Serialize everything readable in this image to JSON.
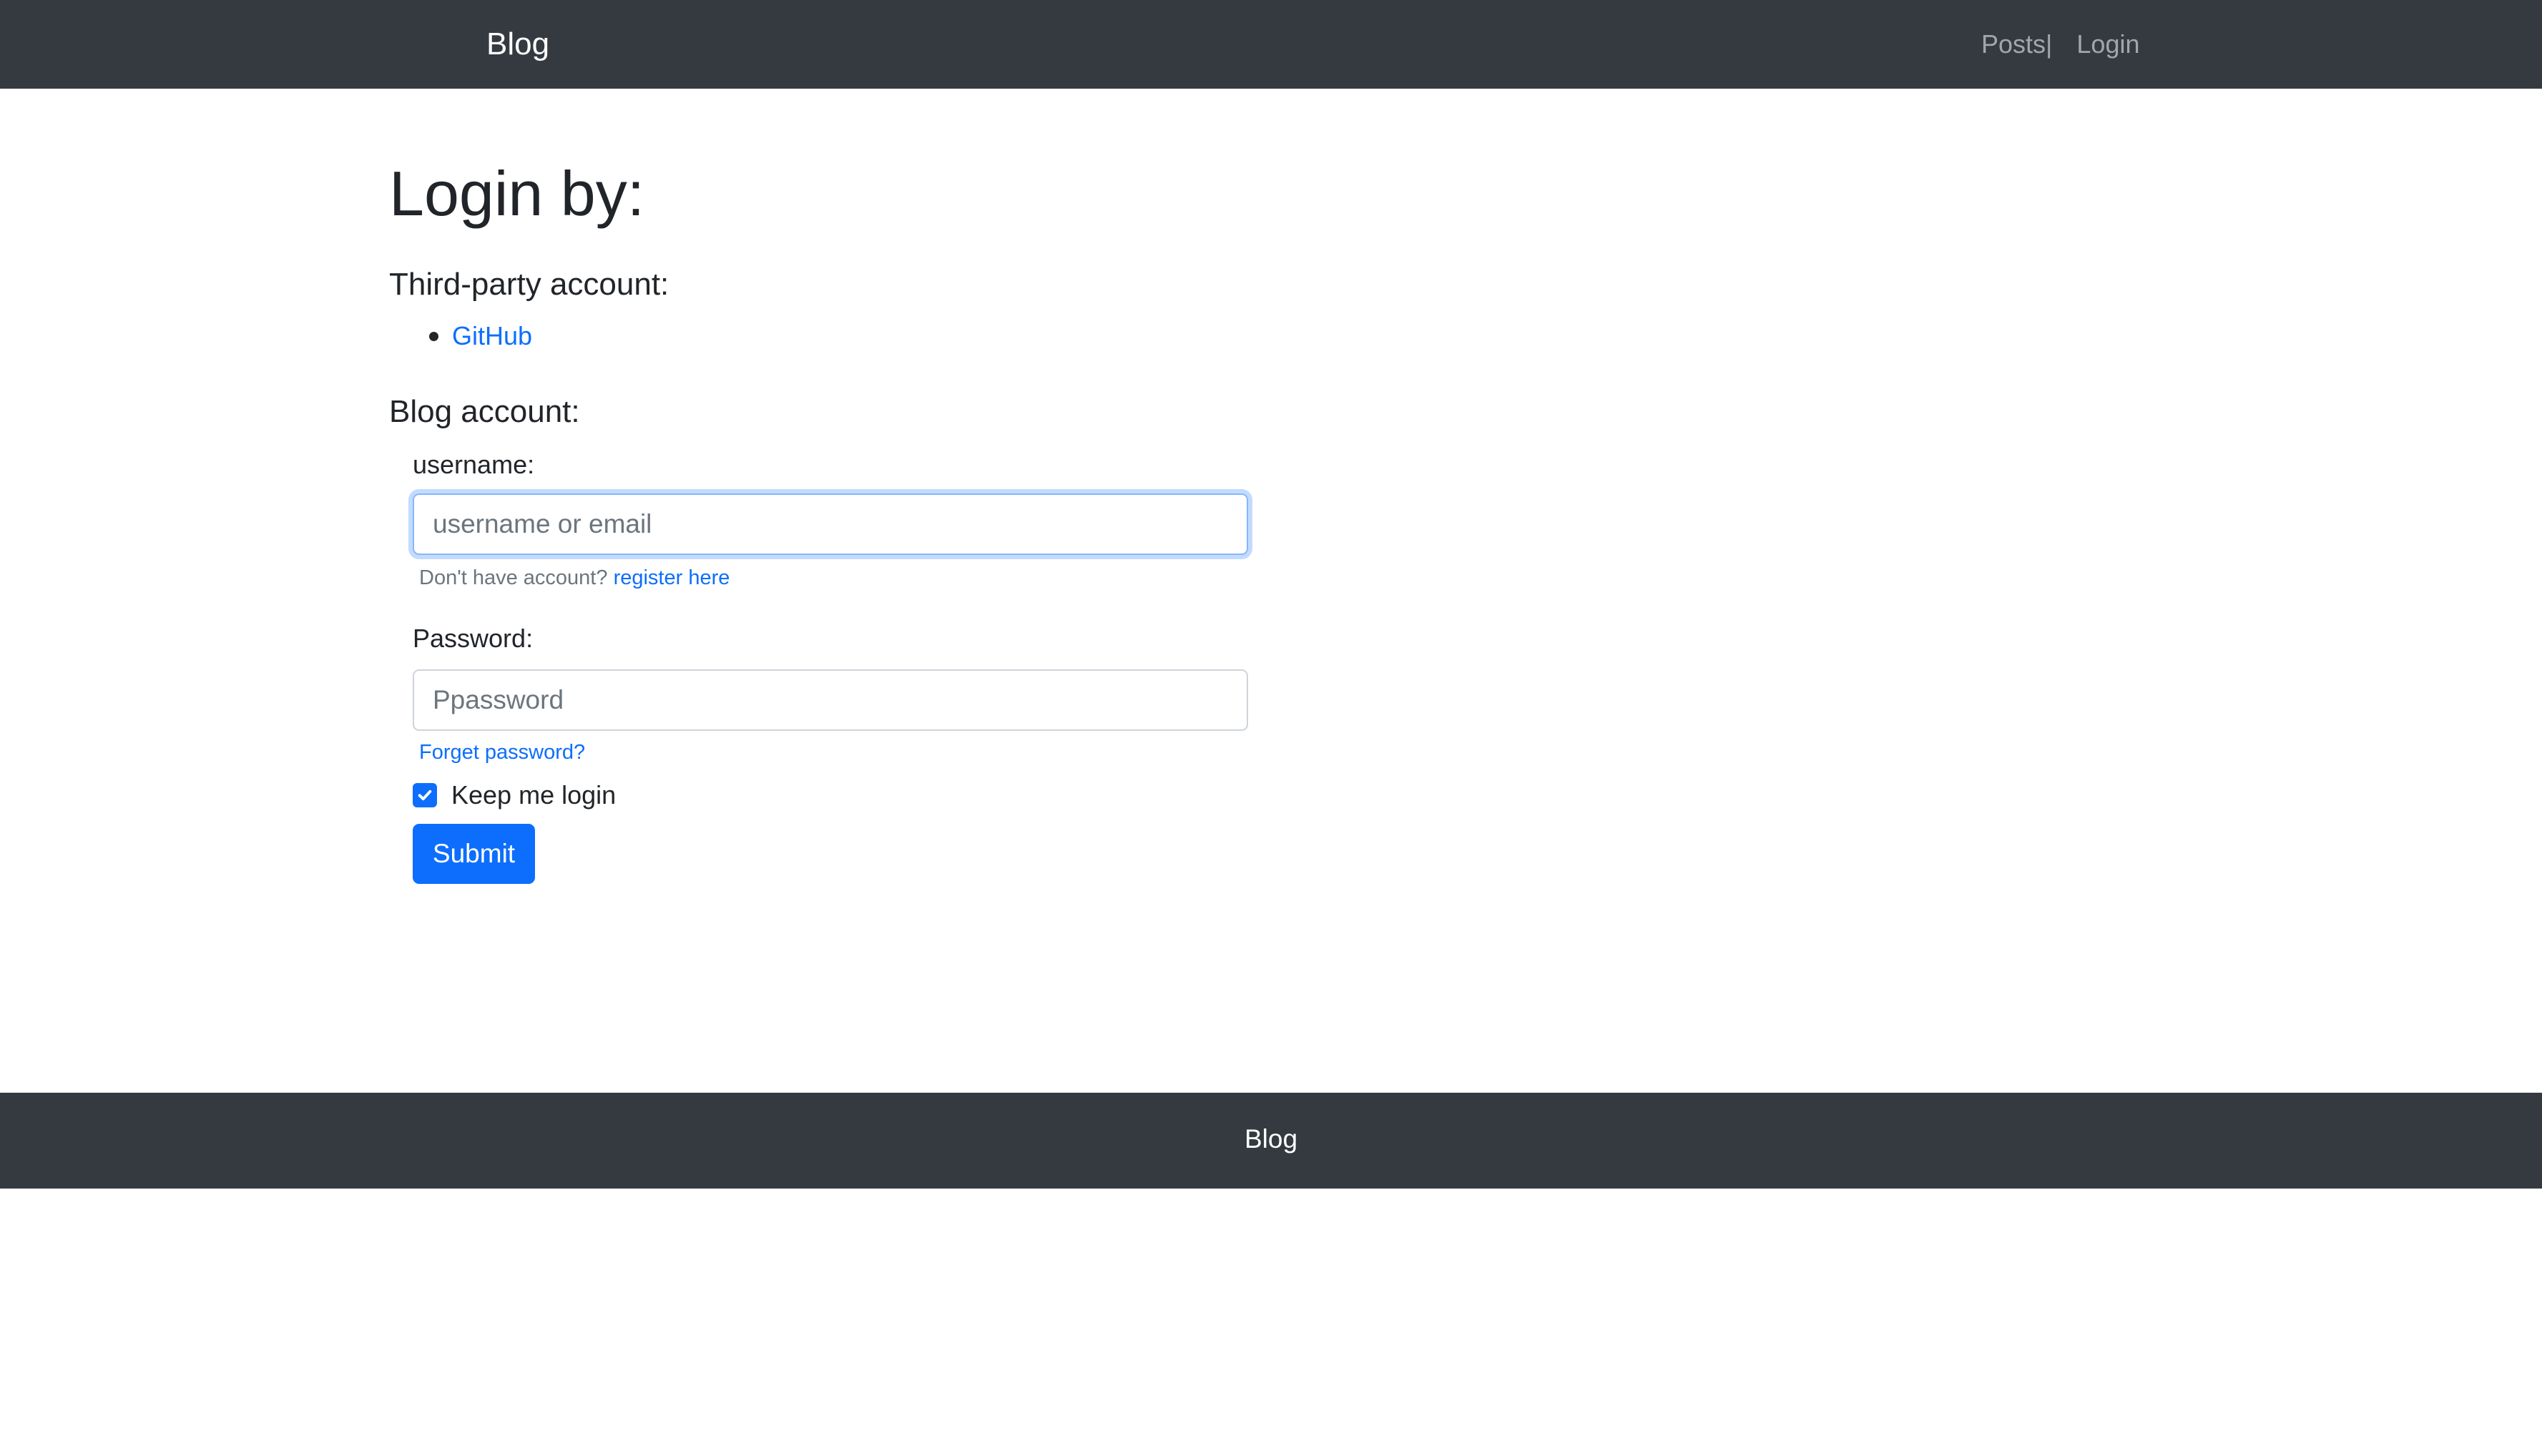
{
  "navbar": {
    "brand": "Blog",
    "links": [
      {
        "label": "Posts"
      },
      {
        "label": "Login"
      }
    ],
    "separator": "|"
  },
  "page": {
    "title": "Login by:"
  },
  "third_party": {
    "title": "Third-party account:",
    "providers": [
      {
        "label": "GitHub"
      }
    ]
  },
  "blog_account": {
    "title": "Blog account:",
    "username": {
      "label": "username:",
      "value": "",
      "placeholder": "username or email",
      "help_prefix": "Don't have account?",
      "register_link": "register here"
    },
    "password": {
      "label": "Password:",
      "value": "",
      "placeholder": "Ppassword",
      "forget_link": "Forget password?"
    },
    "keep_login": {
      "label": "Keep me login",
      "checked": true
    },
    "submit_label": "Submit"
  },
  "footer": {
    "text": "Blog"
  },
  "colors": {
    "navbar_bg": "#343a40",
    "link": "#0d6efd",
    "primary": "#0d6efd",
    "text": "#212529",
    "muted": "#6c757d"
  }
}
